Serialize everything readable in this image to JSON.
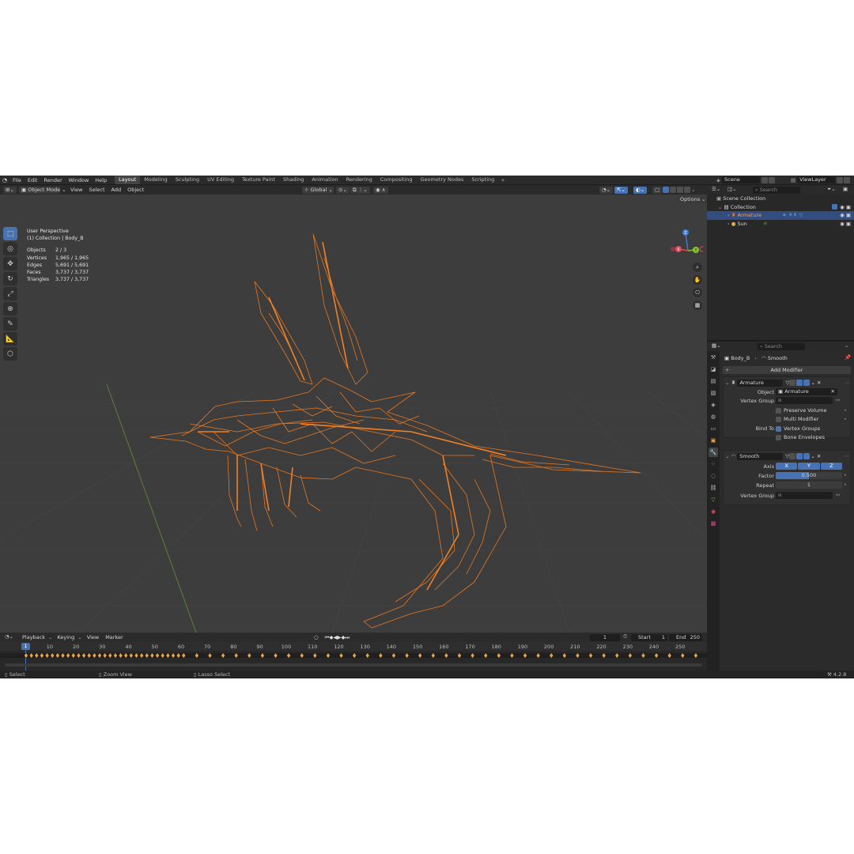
{
  "menus": [
    "File",
    "Edit",
    "Render",
    "Window",
    "Help"
  ],
  "workspaces": [
    "Layout",
    "Modeling",
    "Sculpting",
    "UV Editing",
    "Texture Paint",
    "Shading",
    "Animation",
    "Rendering",
    "Compositing",
    "Geometry Nodes",
    "Scripting"
  ],
  "active_workspace": "Layout",
  "scene": {
    "label": "Scene",
    "viewlayer": "ViewLayer"
  },
  "viewport_header": {
    "mode": "Object Mode",
    "menus": [
      "View",
      "Select",
      "Add",
      "Object"
    ],
    "transform_orientation": "Global",
    "options": "Options"
  },
  "viewport": {
    "title": "User Perspective",
    "collection": "(1) Collection | Body_B",
    "stats": [
      {
        "label": "Objects",
        "value": "2 / 3"
      },
      {
        "label": "Vertices",
        "value": "1,965 / 1,965"
      },
      {
        "label": "Edges",
        "value": "5,691 / 5,691"
      },
      {
        "label": "Faces",
        "value": "3,737 / 3,737"
      },
      {
        "label": "Triangles",
        "value": "3,737 / 3,737"
      }
    ],
    "gizmo": {
      "x": "X",
      "y": "Y",
      "z": "Z"
    }
  },
  "outliner": {
    "search_placeholder": "Search",
    "root": "Scene Collection",
    "collection": "Collection",
    "items": [
      {
        "name": "Armature",
        "selected": true
      },
      {
        "name": "Sun",
        "selected": false
      }
    ]
  },
  "properties": {
    "search_placeholder": "Search",
    "breadcrumb_object": "Body_B",
    "breadcrumb_modifier": "Smooth",
    "add_modifier": "Add Modifier",
    "armature_mod": {
      "name": "Armature",
      "object_label": "Object",
      "object_value": "Armature",
      "vertex_group_label": "Vertex Group",
      "preserve_volume": "Preserve Volume",
      "multi_modifier": "Multi Modifier",
      "bind_to_label": "Bind To",
      "vertex_groups": "Vertex Groups",
      "bone_envelopes": "Bone Envelopes"
    },
    "smooth_mod": {
      "name": "Smooth",
      "axis_label": "Axis",
      "axes": [
        "X",
        "Y",
        "Z"
      ],
      "factor_label": "Factor",
      "factor_value": "0.500",
      "repeat_label": "Repeat",
      "repeat_value": "1",
      "vertex_group_label": "Vertex Group"
    }
  },
  "timeline": {
    "menus": [
      "Playback",
      "Keying",
      "View",
      "Marker"
    ],
    "current_frame": "1",
    "start_label": "Start",
    "start_value": "1",
    "end_label": "End",
    "end_value": "250",
    "ticks": [
      "10",
      "20",
      "30",
      "40",
      "50",
      "60",
      "70",
      "80",
      "90",
      "100",
      "110",
      "120",
      "130",
      "140",
      "150",
      "160",
      "170",
      "180",
      "190",
      "200",
      "210",
      "220",
      "230",
      "240",
      "250"
    ]
  },
  "statusbar": {
    "select": "Select",
    "zoom": "Zoom View",
    "lasso": "Lasso Select",
    "version": "4.2.8"
  },
  "colors": {
    "accent": "#4772b3",
    "wire": "#e8771f",
    "viewport_bg": "#3d3d3d",
    "axis_x": "#e04a5a",
    "axis_y": "#8ac22e",
    "axis_z": "#3f7ed8"
  }
}
